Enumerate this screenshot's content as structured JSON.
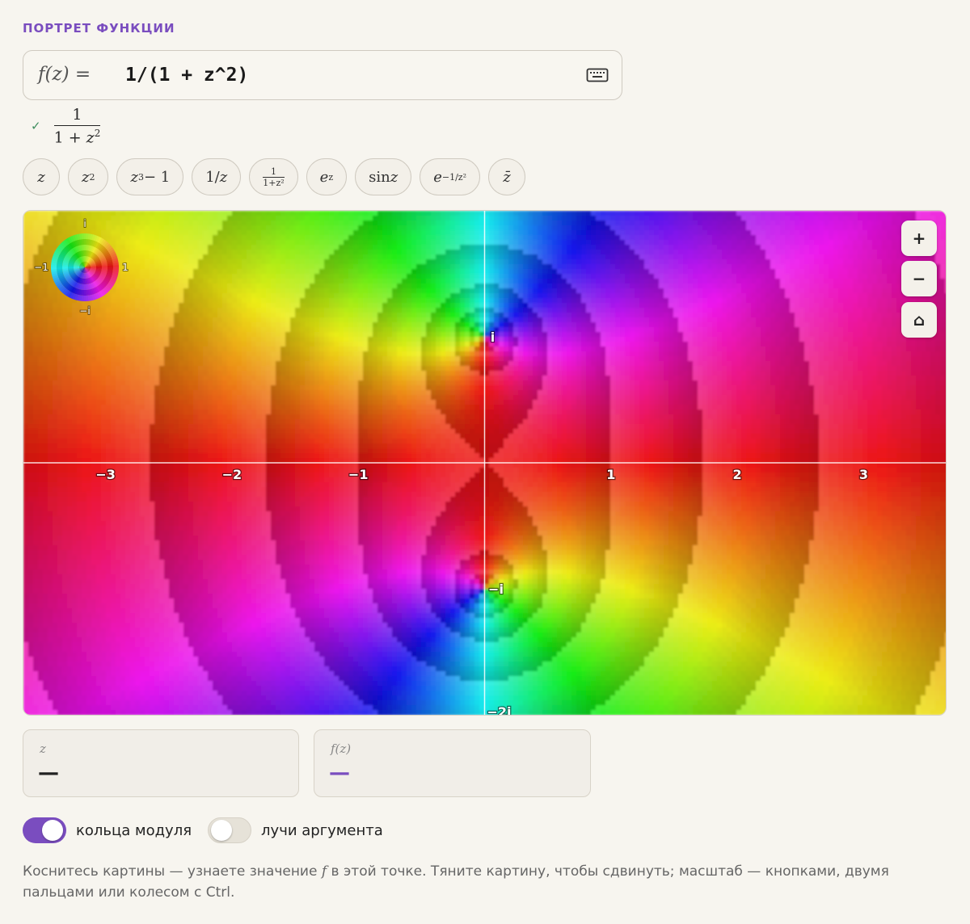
{
  "section_title": "ПОРТРЕТ ФУНКЦИИ",
  "input": {
    "prefix": "f(z) =",
    "value": "1/(1 + z^2)"
  },
  "preview": {
    "numerator": "1",
    "denominator_a": "1 + ",
    "denominator_var": "z",
    "denominator_exp": "2"
  },
  "presets": [
    {
      "base": "z",
      "sup": ""
    },
    {
      "base": "z",
      "sup": "2"
    },
    {
      "base": "z",
      "sup": "3",
      "tail": " − 1"
    },
    {
      "plain": "1/",
      "ital": "z"
    },
    {
      "frac_num": "1",
      "frac_den": "1+z²"
    },
    {
      "base": "e",
      "sup": "z"
    },
    {
      "plain": "sin ",
      "ital": "z"
    },
    {
      "base": "e",
      "sup": "−1/z²"
    },
    {
      "plain": "",
      "ital": "z̄"
    }
  ],
  "plot": {
    "x_ticks": [
      "−3",
      "−2",
      "−1",
      "1",
      "2",
      "3"
    ],
    "y_labels": {
      "top": "i",
      "bottom": "−i",
      "lower": "−2i"
    },
    "legend_labels": {
      "up": "i",
      "down": "−i",
      "left": "−1",
      "right": "1"
    },
    "controls": {
      "zoom_in": "+",
      "zoom_out": "−",
      "home": "⌂"
    },
    "x_range": [
      -3.65,
      3.65
    ],
    "y_range": [
      -2.0,
      2.0
    ]
  },
  "readouts": {
    "z_label": "z",
    "z_value": "—",
    "fz_label": "f(z)",
    "fz_value": "—",
    "accent": "#7a4dbf"
  },
  "toggles": {
    "rings_label": "кольца модуля",
    "rings_on": true,
    "rays_label": "лучи аргумента",
    "rays_on": false
  },
  "hint": {
    "before": "Коснитесь картины — узнаете значение ",
    "var": "f",
    "after": " в этой точке. Тяните картину, чтобы сдвинуть; масштаб — кнопками, двумя пальцами или колесом с Ctrl."
  }
}
